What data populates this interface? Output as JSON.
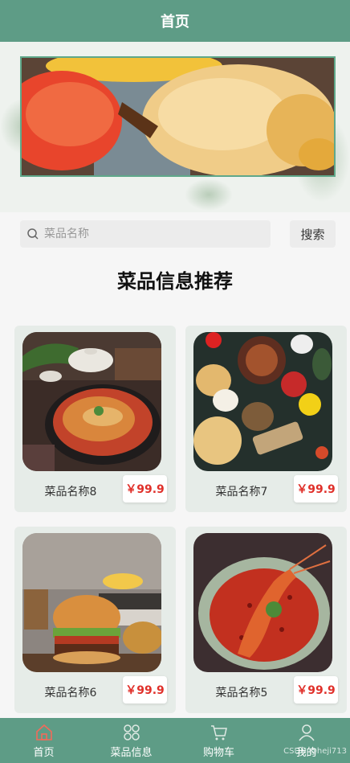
{
  "header": {
    "title": "首页"
  },
  "search": {
    "placeholder": "菜品名称",
    "button_label": "搜索"
  },
  "section": {
    "title": "菜品信息推荐"
  },
  "dishes": [
    {
      "name": "菜品名称8",
      "price": "￥99.9",
      "image": "fish-hotpot-photo"
    },
    {
      "name": "菜品名称7",
      "price": "￥99.9",
      "image": "food-spread-photo"
    },
    {
      "name": "菜品名称6",
      "price": "￥99.9",
      "image": "burger-photo"
    },
    {
      "name": "菜品名称5",
      "price": "￥99.9",
      "image": "crayfish-chili-photo"
    }
  ],
  "tabbar": {
    "items": [
      {
        "label": "首页",
        "icon": "home-icon"
      },
      {
        "label": "菜品信息",
        "icon": "grid-icon"
      },
      {
        "label": "购物车",
        "icon": "cart-icon"
      },
      {
        "label": "我的",
        "icon": "user-icon"
      }
    ]
  },
  "watermark": "CSDN @heji713",
  "colors": {
    "primary": "#5e9c86",
    "price": "#e0302a"
  }
}
